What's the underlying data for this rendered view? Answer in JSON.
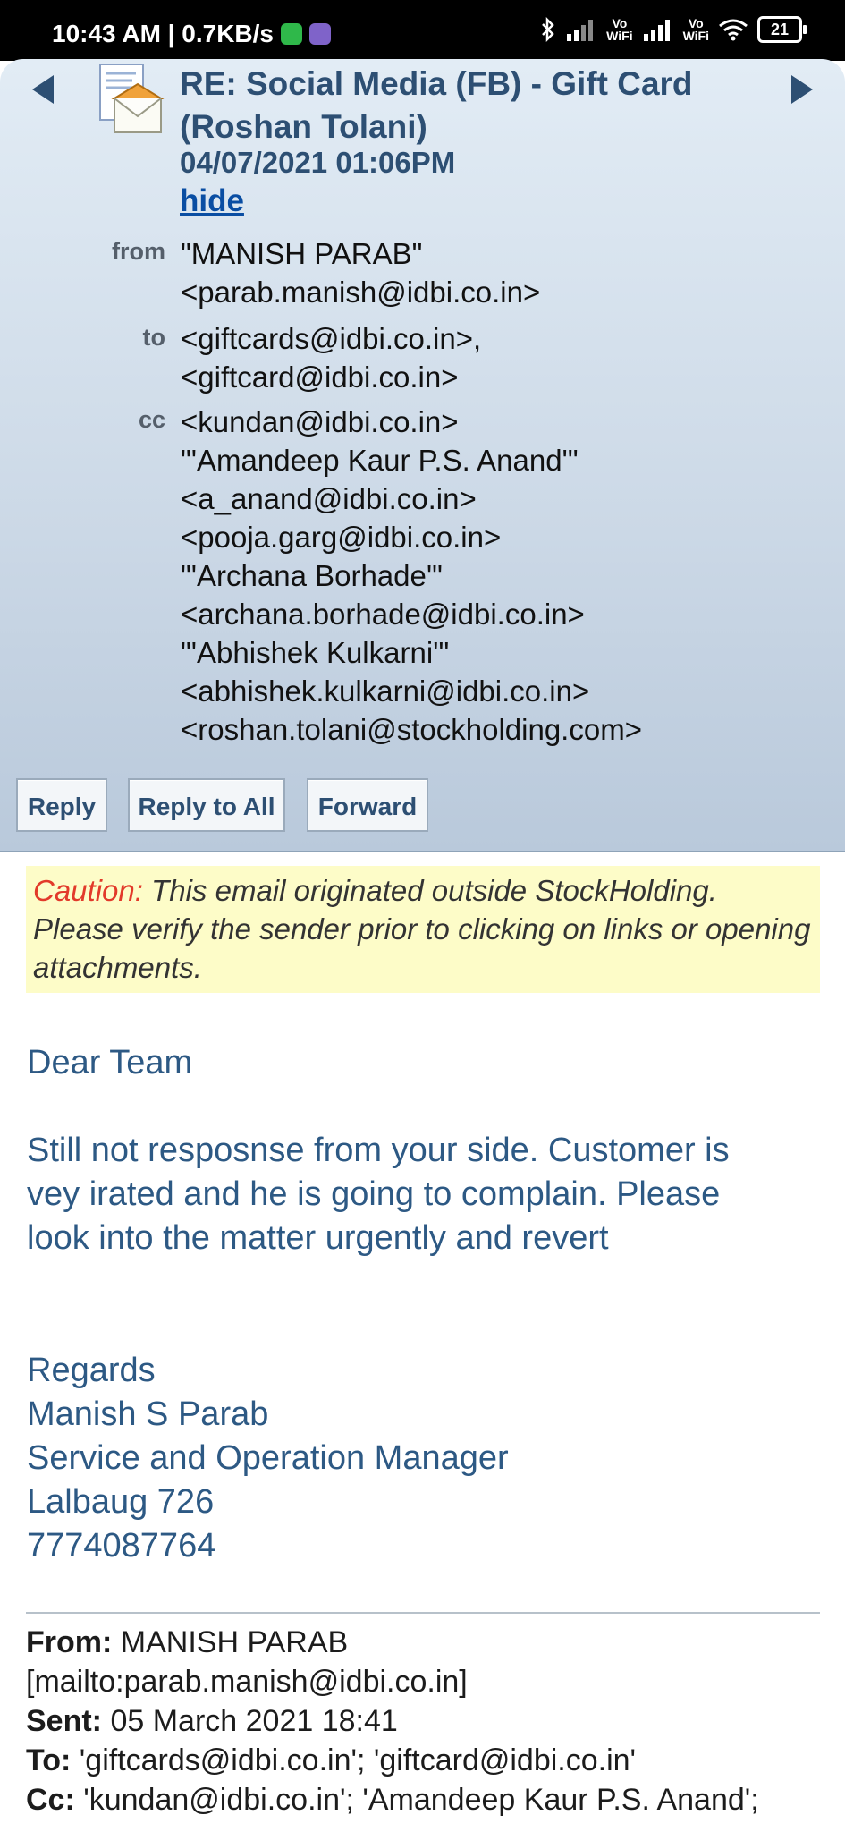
{
  "status_bar": {
    "time_speed": "10:43 AM | 0.7KB/s",
    "wifi_labels": [
      "Vo",
      "WiFi"
    ],
    "battery": "21"
  },
  "email": {
    "subject": "RE: Social Media (FB) - Gift Card (Roshan Tolani)",
    "date": "04/07/2021 01:06PM",
    "hide_link": "hide",
    "from_label": "from",
    "from_lines": [
      "\"MANISH PARAB\"",
      "<parab.manish@idbi.co.in>"
    ],
    "to_label": "to",
    "to_lines": [
      "<giftcards@idbi.co.in>,",
      "<giftcard@idbi.co.in>"
    ],
    "cc_label": "cc",
    "cc_lines": [
      "<kundan@idbi.co.in>",
      "\"'Amandeep Kaur P.S. Anand'\"",
      "<a_anand@idbi.co.in>",
      "<pooja.garg@idbi.co.in>",
      "\"'Archana Borhade'\"",
      "<archana.borhade@idbi.co.in>",
      "\"'Abhishek Kulkarni'\"",
      "<abhishek.kulkarni@idbi.co.in>",
      "<roshan.tolani@stockholding.com>"
    ]
  },
  "actions": {
    "reply": "Reply",
    "reply_all": "Reply to All",
    "forward": "Forward"
  },
  "caution": {
    "label": "Caution:",
    "text": " This email originated outside StockHolding. Please verify the sender prior to clicking on links or opening attachments."
  },
  "body": {
    "greeting": "Dear Team",
    "paragraph_lines": [
      "Still not resposnse from your side. Customer is",
      "vey irated and he is going to complain. Please",
      "look into the matter urgently and revert"
    ],
    "signature_lines": [
      "Regards",
      "Manish S Parab",
      "Service and Operation Manager",
      "Lalbaug 726",
      "7774087764"
    ]
  },
  "original_message": {
    "from_label": "From:",
    "from_value": " MANISH PARAB",
    "from_mailto": "[mailto:parab.manish@idbi.co.in]",
    "sent_label": "Sent:",
    "sent_value": " 05 March 2021 18:41",
    "to_label": "To:",
    "to_value": " 'giftcards@idbi.co.in'; 'giftcard@idbi.co.in'",
    "cc_label": "Cc:",
    "cc_value": " 'kundan@idbi.co.in'; 'Amandeep Kaur P.S. Anand';"
  },
  "colors": {
    "header_text": "#2d4f73",
    "body_text": "#2d5984",
    "caution_bg": "#fdfcc8",
    "caution_label": "#e23a2a"
  }
}
